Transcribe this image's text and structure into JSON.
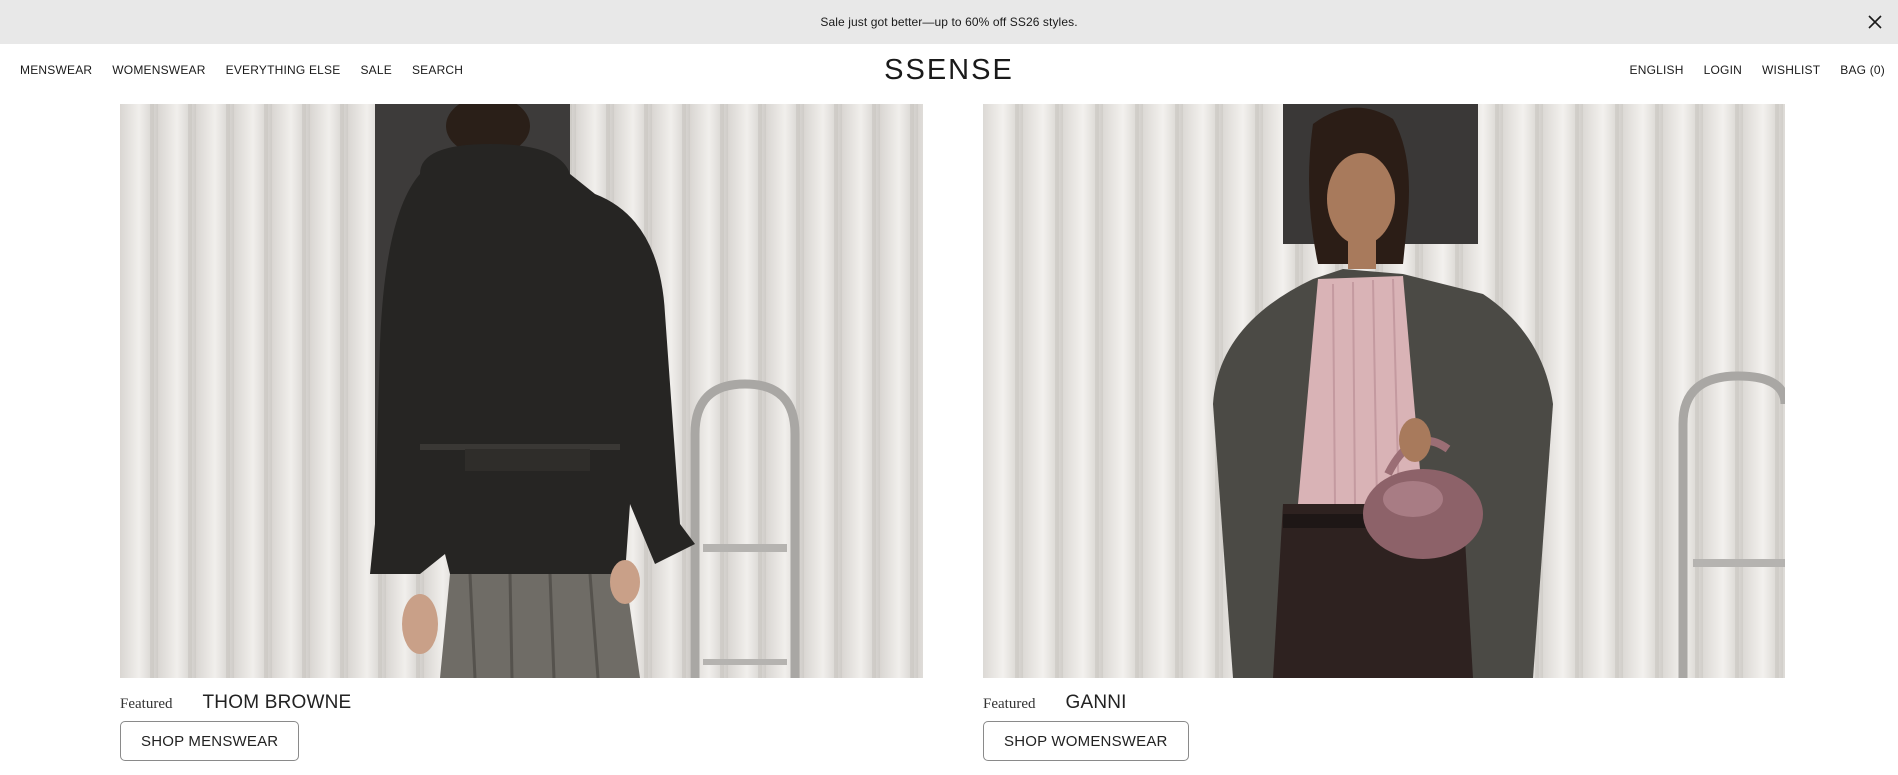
{
  "announcement": {
    "text": "Sale just got better—up to 60% off SS26 styles.",
    "close_icon": "close-icon"
  },
  "header": {
    "logo": "SSENSE",
    "nav_left": [
      "MENSWEAR",
      "WOMENSWEAR",
      "EVERYTHING ELSE",
      "SALE",
      "SEARCH"
    ],
    "nav_right": [
      "ENGLISH",
      "LOGIN",
      "WISHLIST",
      "BAG (0)"
    ]
  },
  "panels": [
    {
      "featured_label": "Featured",
      "brand": "THOM BROWNE",
      "button_label": "SHOP MENSWEAR",
      "image": "menswear-editorial-image"
    },
    {
      "featured_label": "Featured",
      "brand": "GANNI",
      "button_label": "SHOP WOMENSWEAR",
      "image": "womenswear-editorial-image"
    }
  ],
  "colors": {
    "announcement_bg": "#e8e8e8",
    "text": "#1a1a1a",
    "button_border": "#8a8a8a"
  }
}
